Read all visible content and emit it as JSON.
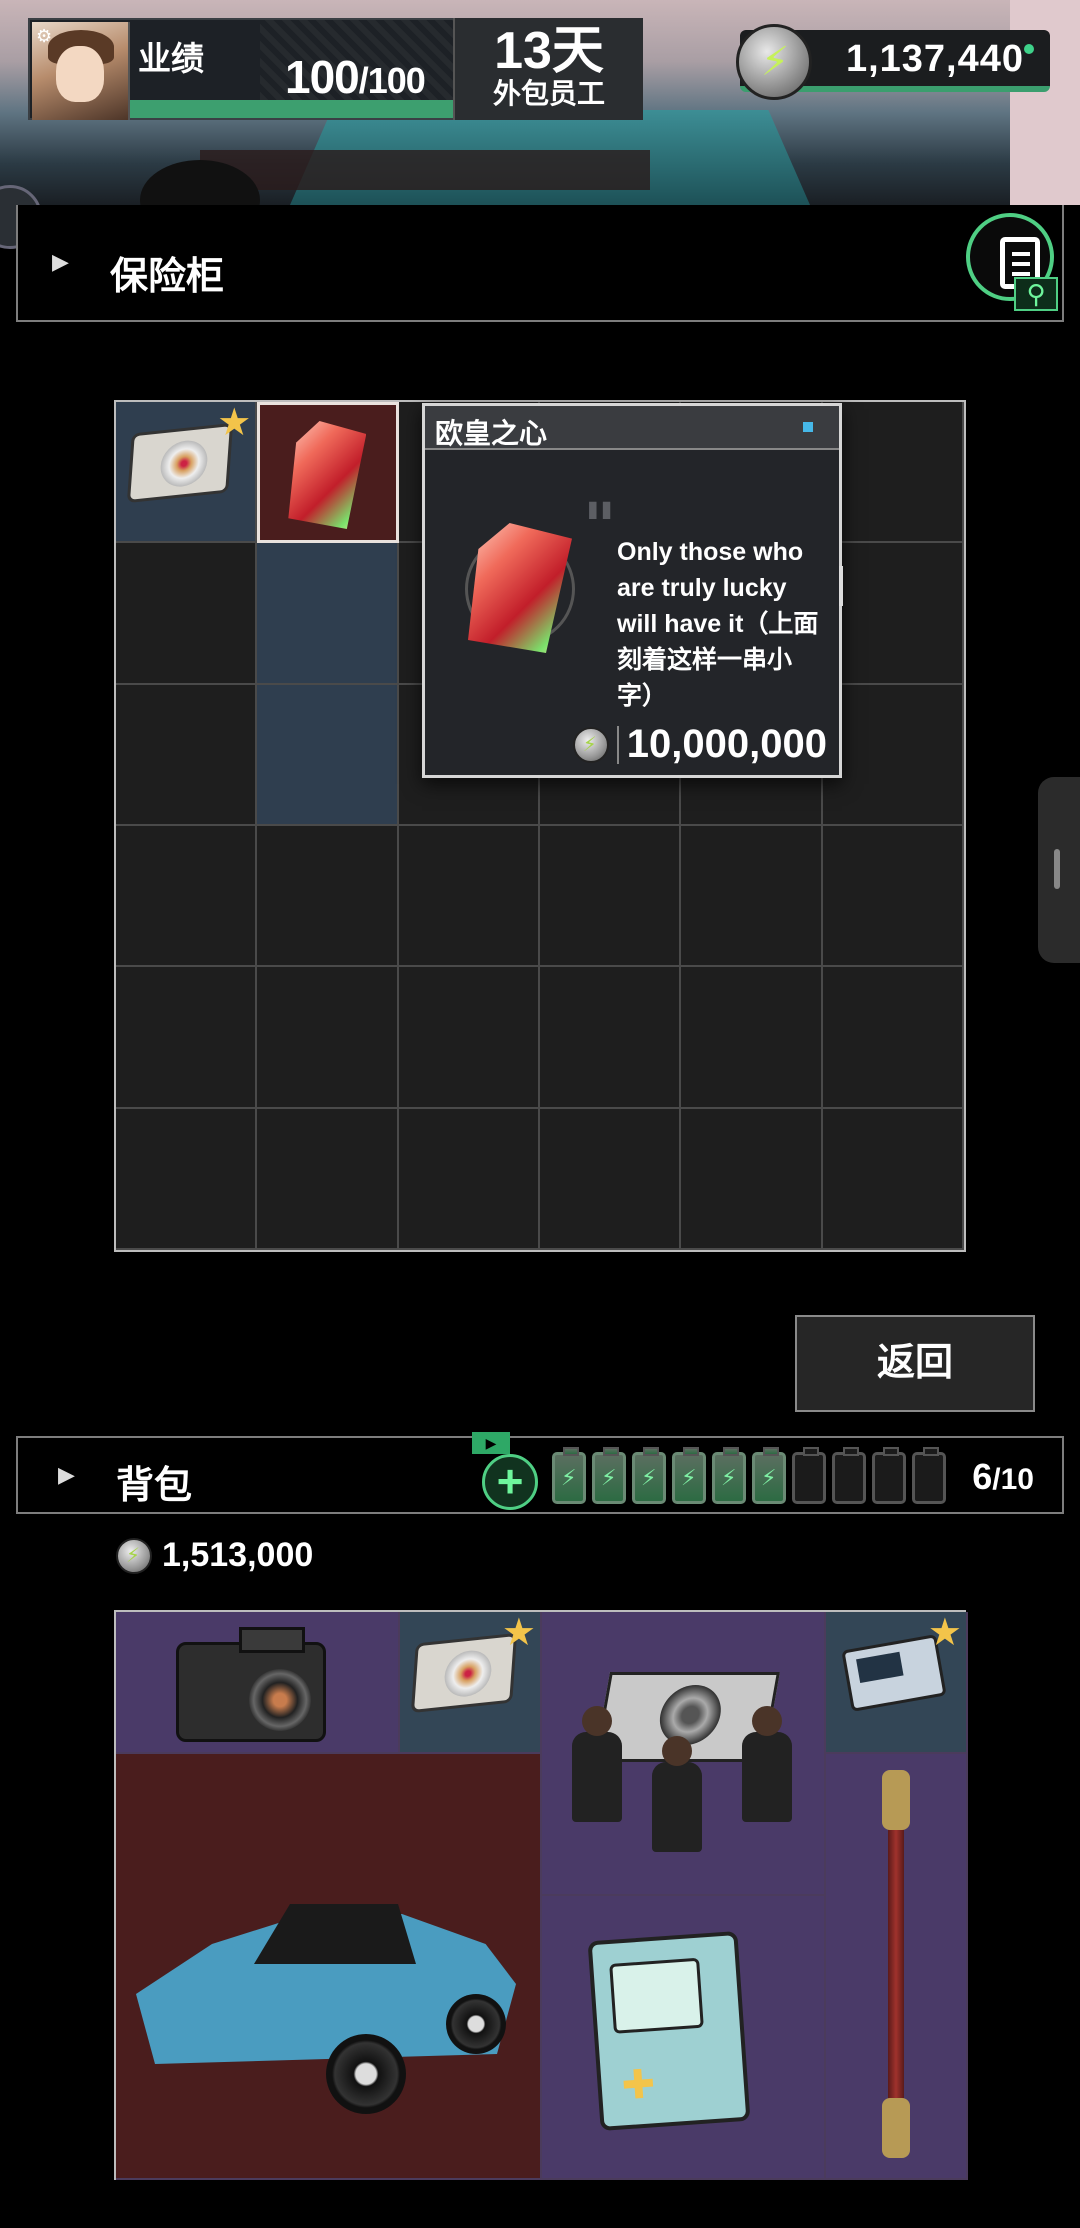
{
  "hud": {
    "performance_label": "业绩",
    "performance_current": "100",
    "performance_max": "/100",
    "performance_fraction": 1.0,
    "days": "13天",
    "role": "外包员工",
    "coins": "1,137,440"
  },
  "safe": {
    "title": "保险柜",
    "items": [
      {
        "icon": "disc-item-icon",
        "starred": true
      },
      {
        "icon": "gem-item-icon",
        "starred": false,
        "selected": true
      }
    ]
  },
  "tooltip": {
    "name": "欧皇之心",
    "description": "Only those who are truly lucky will have it（上面刻着这样一串小字）",
    "price": "10,000,000"
  },
  "buttons": {
    "return_label": "返回"
  },
  "backpack": {
    "title": "背包",
    "add_tag": "▶",
    "add_symbol": "+",
    "count_current": "6",
    "count_max": "/10",
    "batteries_full": 6,
    "batteries_total": 10,
    "money": "1,513,000",
    "items": [
      {
        "icon": "camera-item-icon",
        "starred": false
      },
      {
        "icon": "disc-item-icon",
        "starred": true
      },
      {
        "icon": "dancing-pallbearers-item-icon",
        "starred": false
      },
      {
        "icon": "floppy-drive-item-icon",
        "starred": true
      },
      {
        "icon": "sports-car-item-icon",
        "starred": false
      },
      {
        "icon": "bmo-console-item-icon",
        "starred": false
      },
      {
        "icon": "staff-item-icon",
        "starred": false
      }
    ]
  },
  "colors": {
    "accent_green": "#4fcf84",
    "star_gold": "#f3c44a",
    "cell_purple": "#4a3a68",
    "cell_red": "#4a1d1d",
    "cell_slate": "#334656"
  }
}
